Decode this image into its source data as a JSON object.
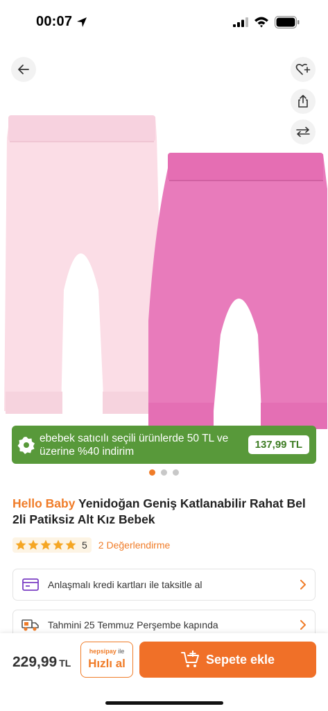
{
  "status_bar": {
    "time": "00:07"
  },
  "icons": {
    "back": "arrow-left-icon",
    "favorite": "heart-add-icon",
    "share": "share-icon",
    "compare": "compare-arrows-icon",
    "promo": "discount-badge-icon",
    "credit": "credit-card-icon",
    "delivery": "truck-icon",
    "cart": "cart-add-icon"
  },
  "promo": {
    "text": "ebebek satıcılı seçili ürünlerde 50 TL ve üzerine %40 indirim",
    "price": "137,99 TL",
    "color": "#58993a"
  },
  "carousel": {
    "total": 3,
    "active": 1
  },
  "product": {
    "brand": "Hello Baby",
    "name": " Yenidoğan Geniş Katlanabilir Rahat Bel 2li Patiksiz Alt Kız Bebek"
  },
  "rating": {
    "score": "5",
    "stars": 5,
    "reviews_label": "2 Değerlendirme"
  },
  "info_rows": {
    "credit": "Anlaşmalı kredi kartları ile taksitle al",
    "delivery": "Tahmini 25 Temmuz Perşembe kapında"
  },
  "bottom_bar": {
    "price": "229,99",
    "currency": "TL",
    "quick_buy_top_brand": "hepsipay",
    "quick_buy_top_suffix": " ile",
    "quick_buy_label": "Hızlı al",
    "add_to_cart_label": "Sepete ekle"
  },
  "colors": {
    "accent": "#f07c28",
    "promo_green": "#58993a",
    "light_pink": "#fbdde7",
    "pink": "#e676b6"
  }
}
